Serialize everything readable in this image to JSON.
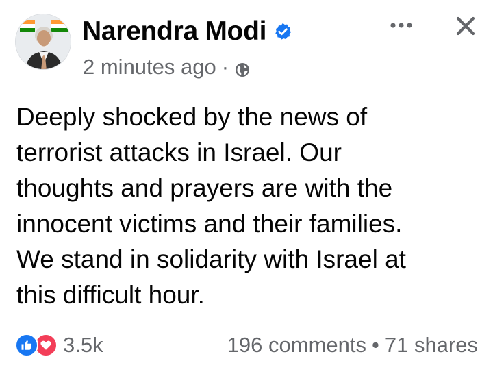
{
  "author": {
    "name": "Narendra Modi",
    "verified_icon": "verified-badge-icon",
    "avatar_icon": "profile-avatar"
  },
  "meta": {
    "timestamp": "2 minutes ago",
    "separator": "·",
    "audience_icon": "globe-icon"
  },
  "header_actions": {
    "more_icon": "more-options-icon",
    "close_icon": "close-icon"
  },
  "post": {
    "text": "Deeply shocked by the news of\nterrorist attacks in Israel. Our\nthoughts and prayers are with the\ninnocent victims and their families.\nWe stand in solidarity with Israel at\nthis difficult hour."
  },
  "footer": {
    "reaction_icons": [
      "like-icon",
      "love-icon"
    ],
    "reaction_count": "3.5k",
    "comments": "196 comments",
    "separator": "•",
    "shares": "71 shares"
  },
  "colors": {
    "text": "#050505",
    "secondary": "#65676b",
    "brand_blue": "#1877f2",
    "love_red": "#f33e58"
  }
}
